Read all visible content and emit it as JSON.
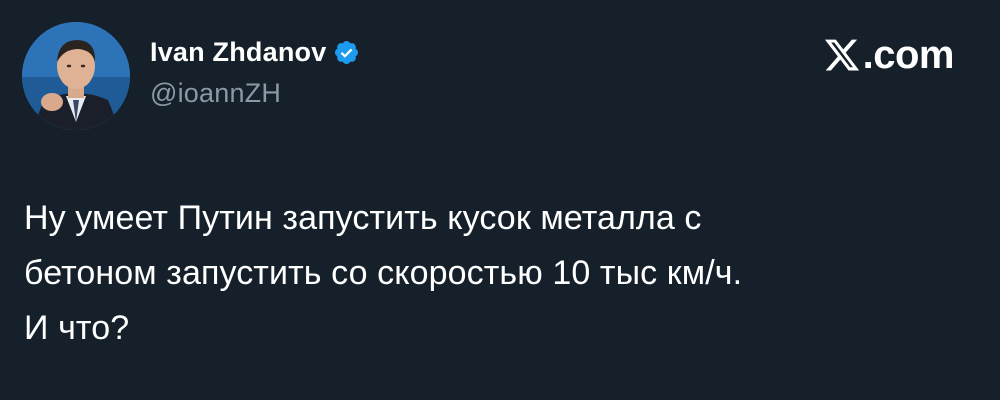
{
  "tweet": {
    "author": {
      "display_name": "Ivan Zhdanov",
      "handle": "@ioannZH",
      "verified": true,
      "avatar_icon": "avatar-photo"
    },
    "brand": {
      "icon": "x-logo-icon",
      "text": ".com"
    },
    "text": "Ну умеет Путин запустить кусок металла с\nбетоном запустить со скоростью 10 тыс км/ч.\nИ что?"
  },
  "colors": {
    "background": "#15202b",
    "text": "#ffffff",
    "handle": "#8b98a5",
    "verified": "#1d9bf0"
  }
}
